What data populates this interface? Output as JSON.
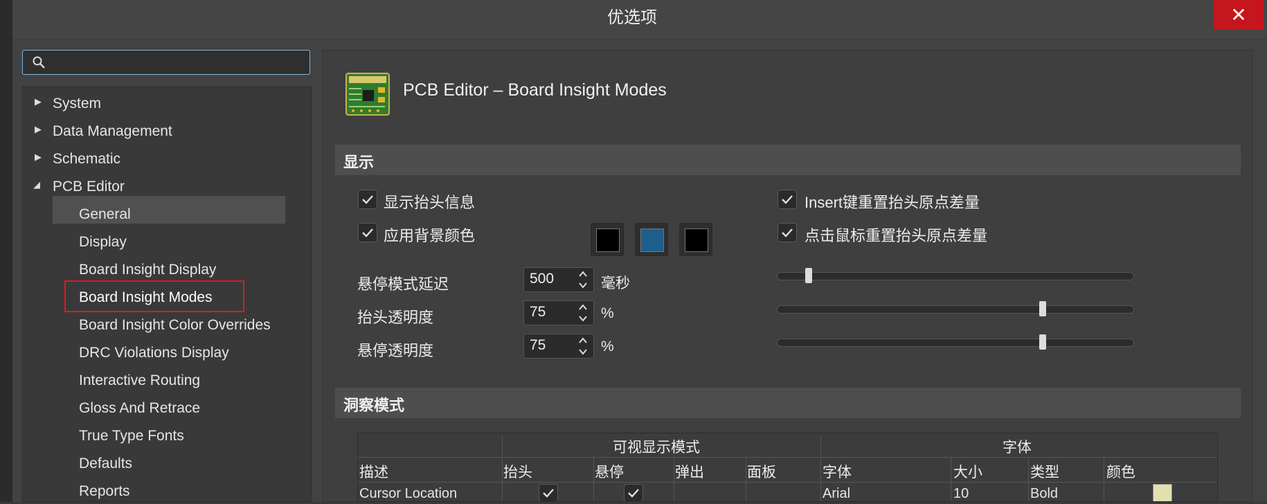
{
  "window": {
    "title": "优选项",
    "close_label": "✕"
  },
  "search": {
    "value": "",
    "placeholder": ""
  },
  "tree": {
    "items": [
      {
        "label": "System",
        "expanded": false
      },
      {
        "label": "Data Management",
        "expanded": false
      },
      {
        "label": "Schematic",
        "expanded": false
      },
      {
        "label": "PCB Editor",
        "expanded": true
      }
    ],
    "children": [
      "General",
      "Display",
      "Board Insight Display",
      "Board Insight Modes",
      "Board Insight Color Overrides",
      "DRC Violations Display",
      "Interactive Routing",
      "Gloss And Retrace",
      "True Type Fonts",
      "Defaults",
      "Reports"
    ],
    "selected": "Board Insight Modes"
  },
  "panel": {
    "title": "PCB Editor – Board Insight Modes",
    "display_section": "显示",
    "show_heads_up": {
      "label": "显示抬头信息",
      "checked": true
    },
    "apply_bg_color": {
      "label": "应用背景颜色",
      "checked": true
    },
    "insert_reset": {
      "label": "Insert键重置抬头原点差量",
      "checked": true
    },
    "click_reset": {
      "label": "点击鼠标重置抬头原点差量",
      "checked": true
    },
    "swatch_colors": [
      "#000000",
      "#1e5e8a",
      "#000000"
    ],
    "hover_delay": {
      "label": "悬停模式延迟",
      "value": "500",
      "unit": "毫秒",
      "slider": 0.08
    },
    "heads_up_opacity": {
      "label": "抬头透明度",
      "value": "75",
      "unit": "%",
      "slider": 0.75
    },
    "hover_opacity": {
      "label": "悬停透明度",
      "value": "75",
      "unit": "%",
      "slider": 0.75
    },
    "insight_section": "洞察模式"
  },
  "table": {
    "group_headers": {
      "visible_modes": "可视显示模式",
      "font": "字体"
    },
    "columns": [
      "描述",
      "抬头",
      "悬停",
      "弹出",
      "面板",
      "字体",
      "大小",
      "类型",
      "颜色"
    ],
    "rows": [
      {
        "description": "Cursor Location",
        "heads_up": true,
        "hover": true,
        "popup": false,
        "panel": false,
        "font": "Arial",
        "size": "10",
        "style": "Bold",
        "color": "#e3e0b0"
      }
    ]
  },
  "colors": {
    "accent_red": "#d21f26",
    "close_bg": "#c4161c",
    "search_border": "#7fb7e0"
  }
}
